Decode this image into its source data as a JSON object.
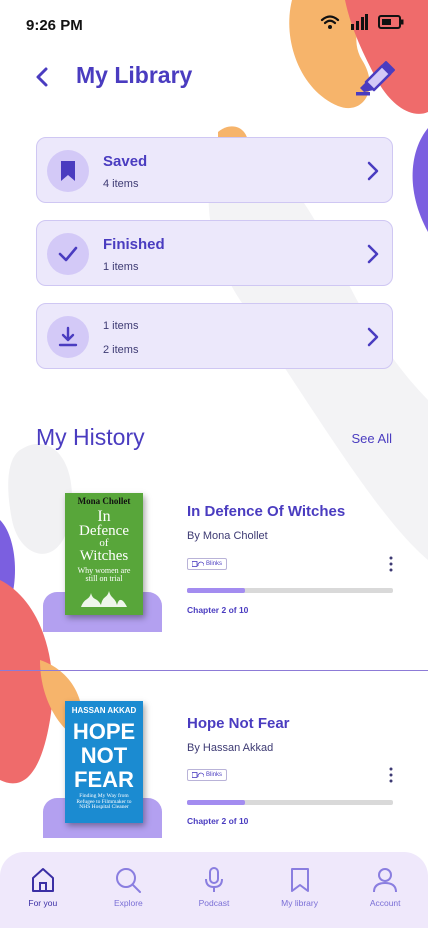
{
  "status_bar": {
    "time": "9:26 PM"
  },
  "header": {
    "title": "My Library"
  },
  "library_cards": [
    {
      "label": "Saved",
      "count": "4 items"
    },
    {
      "label": "Finished",
      "count": "1 items"
    },
    {
      "line1": "1 items",
      "line2": "2 items"
    }
  ],
  "history": {
    "title": "My History",
    "see_all": "See All",
    "books": [
      {
        "title": "In Defence Of Witches",
        "author": "By Mona Chollet",
        "badge": "Blinks",
        "chapter": "Chapter 2 of 10",
        "progress": 0.28,
        "cover": {
          "author": "Mona Chollet",
          "line1": "In",
          "line2": "Defence",
          "line3": "of",
          "line4": "Witches",
          "tag": "Why women are still on trial"
        }
      },
      {
        "title": "Hope Not Fear",
        "author": "By Hassan Akkad",
        "badge": "Blinks",
        "chapter": "Chapter 2 of 10",
        "progress": 0.28,
        "cover": {
          "author": "HASSAN AKKAD",
          "line1": "HOPE",
          "line2": "NOT",
          "line3": "FEAR",
          "tag": "Finding My Way from Refugee to Filmmaker to NHS Hospital Cleaner"
        }
      }
    ]
  },
  "nav": [
    {
      "label": "For you",
      "icon": "home-icon",
      "active": true
    },
    {
      "label": "Explore",
      "icon": "search-icon",
      "active": false
    },
    {
      "label": "Podcast",
      "icon": "microphone-icon",
      "active": false
    },
    {
      "label": "My library",
      "icon": "bookmark-icon",
      "active": false
    },
    {
      "label": "Account",
      "icon": "user-icon",
      "active": false
    }
  ],
  "colors": {
    "accent": "#4a3cc0",
    "card_bg": "#ece8fb",
    "blob_coral": "#ef6b6b",
    "blob_orange": "#f6b46b",
    "blob_purple": "#7b5fe0",
    "progress": "#a38cf0"
  }
}
